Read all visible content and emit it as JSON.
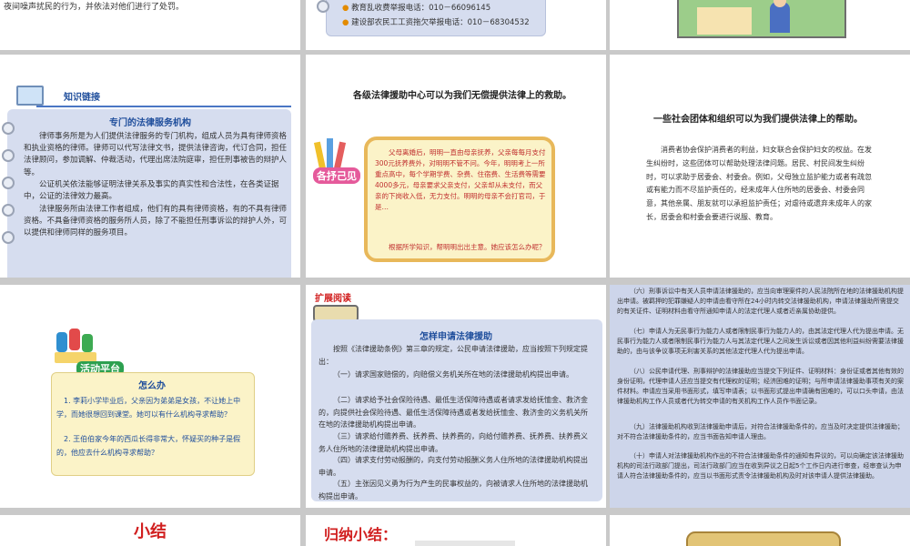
{
  "slides": {
    "s1": {
      "text": "夜间噪声扰民的行为，并依法对他们进行了处罚。"
    },
    "s2": {
      "hotline1": "教育乱收费举报电话：010－66096145",
      "hotline2": "建设部农民工工资拖欠举报电话：010－68304532"
    },
    "s4": {
      "badge": "知识链接",
      "title": "专门的法律服务机构",
      "p1": "律师事务所是为人们提供法律服务的专门机构，组成人员为具有律师资格和执业资格的律师。律师可以代写法律文书，提供法律咨询，代订合同，担任法律顾问，参加调解、仲裁活动，代理出席法院庭审，担任刑事被告的辩护人等。",
      "p2": "公证机关依法能够证明法律关系及事实的真实性和合法性，在各类证据中，公证的法律效力最高。",
      "p3": "法律服务所由法律工作者组成，他们有的具有律师资格，有的不具有律师资格。不具备律师资格的服务所人员，除了不能担任刑事诉讼的辩护人外，可以提供和律师同样的服务项目。"
    },
    "s5": {
      "heading": "各级法律援助中心可以为我们无偿提供法律上的救助。",
      "badge": "各抒己见",
      "story": "父母离婚后，明明一直由母亲抚养，父亲每每月支付300元抚养费外，对明明不管不问。今年，明明考上一所重点高中，每个学期学费、杂费、住宿费、生活费等需要4000多元，母亲要求父亲支付，父亲却从未支付，而父亲的下岗收入低，无力支付。明明的母亲不会打官司，于是…",
      "question": "根据所学知识，帮明明出出主意。她应该怎么办呢？"
    },
    "s6": {
      "heading": "一些社会团体和组织可以为我们提供法律上的帮助。",
      "body": "消费者协会保护消费者的利益，妇女联合会保护妇女的权益。在发生纠纷时，这些团体可以帮助处理法律问题。居民、村民间发生纠纷时，可以求助于居委会、村委会。例如，父母独立监护能力或者有疏忽或有能力而不尽监护责任的，经未成年人住所地的居委会、村委会同意，其他亲属、朋友就可以承担监护责任；对虐待或遗弃未成年人的家长，居委会和村委会要进行说服、教育。"
    },
    "s7": {
      "badge": "活动平台",
      "title": "怎么办",
      "q1": "1. 李莉小学毕业后，父亲因为弟弟是女孩，不让她上中学，而她很想回到课堂。她可以有什么机构寻求帮助？",
      "q2": "2. 王伯伯家今年的西瓜长得非常大，怀疑买的种子是假的，他应去什么机构寻求帮助？"
    },
    "s8": {
      "badge": "扩展阅读",
      "title": "怎样申请法律援助",
      "intro": "按照《法律援助条例》第三章的规定，公民申请法律援助，应当按照下列规定提出：",
      "i1": "（一）请求国家赔偿的，向赔偿义务机关所在地的法律援助机构提出申请。",
      "i2": "（二）请求给予社会保险待遇、最低生活保障待遇或者请求发给抚恤金、救济金的，向提供社会保险待遇、最低生活保障待遇或者发给抚恤金、救济金的义务机关所在地的法律援助机构提出申请。",
      "i3": "（三）请求给付赡养费、抚养费、扶养费的，向给付赡养费、抚养费、扶养费义务人住所地的法律援助机构提出申请。",
      "i4": "（四）请求支付劳动报酬的，向支付劳动报酬义务人住所地的法律援助机构提出申请。",
      "i5": "（五）主张因见义勇为行为产生的民事权益的，向被请求人住所地的法律援助机构提出申请。"
    },
    "s9": {
      "p6": "（六）刑事诉讼中有关人员申请法律援助的，应当向审理案件的人民法院所在地的法律援助机构提出申请。被羁押的犯罪嫌疑人的申请由看守所在24小时内转交法律援助机构，申请法律援助所需提交的有关证件、证明材料由看守所通知申请人的法定代理人或者近亲属协助提供。",
      "p7": "（七）申请人为无民事行为能力人或者限制民事行为能力人的，由其法定代理人代为提出申请。无民事行为能力人或者限制民事行为能力人与其法定代理人之间发生诉讼或者因其他利益纠纷需要法律援助的，由与该争议事项无利害关系的其他法定代理人代为提出申请。",
      "p8": "（八）公民申请代理、刑事辩护的法律援助应当提交下列证件、证明材料：身份证或者其他有效的身份证明，代理申请人还应当提交有代理权的证明；经济困难的证明；与所申请法律援助事项有关的案件材料。申请应当采用书面形式，填写申请表；以书面形式提出申请确有困难的，可以口头申请，由法律援助机构工作人员或者代为转交申请的有关机构工作人员作书面记录。",
      "p9": "（九）法律援助机构收到法律援助申请后，对符合法律援助条件的，应当及时决定提供法律援助；对不符合法律援助条件的，应当书面告知申请人理由。",
      "p10": "（十）申请人对法律援助机构作出的不符合法律援助条件的通知有异议的，可以向确定该法律援助机构的司法行政部门提出，司法行政部门应当在收到异议之日起5个工作日内进行审查，经审查认为申请人符合法律援助条件的，应当以书面形式责令法律援助机构及时对该申请人提供法律援助。"
    },
    "s10": {
      "title": "小结"
    },
    "s11": {
      "title": "归纳小结："
    }
  },
  "colors": {
    "blue_title": "#1f4e9c",
    "red_title": "#d11f1f",
    "card_blue": "#d6ddef",
    "card_yellow": "#fbf3c8"
  }
}
